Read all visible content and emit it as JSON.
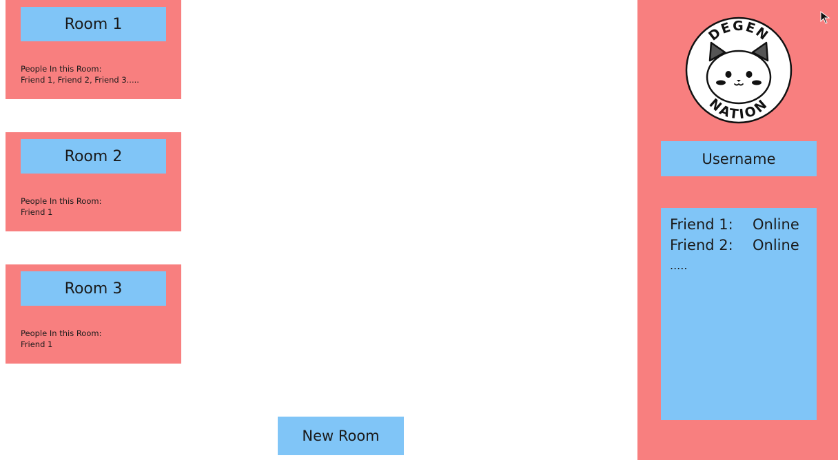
{
  "rooms": [
    {
      "title": "Room 1",
      "people_label": "People In this Room:",
      "people": "Friend 1, Friend 2, Friend 3....."
    },
    {
      "title": "Room 2",
      "people_label": "People In this Room:",
      "people": "Friend 1"
    },
    {
      "title": "Room 3",
      "people_label": "People In this Room:",
      "people": "Friend 1"
    }
  ],
  "actions": {
    "new_room_label": "New Room"
  },
  "sidebar": {
    "logo": {
      "top_text": "DEGEN",
      "bottom_text": "NATION",
      "icon": "cat-face-icon"
    },
    "username_label": "Username",
    "friends": [
      {
        "name": "Friend 1:",
        "status": "Online"
      },
      {
        "name": "Friend 2:",
        "status": "Online"
      }
    ],
    "friends_more": "....."
  },
  "colors": {
    "panel": "#f87f7f",
    "button": "#80c5f7",
    "background": "#ffffff"
  }
}
